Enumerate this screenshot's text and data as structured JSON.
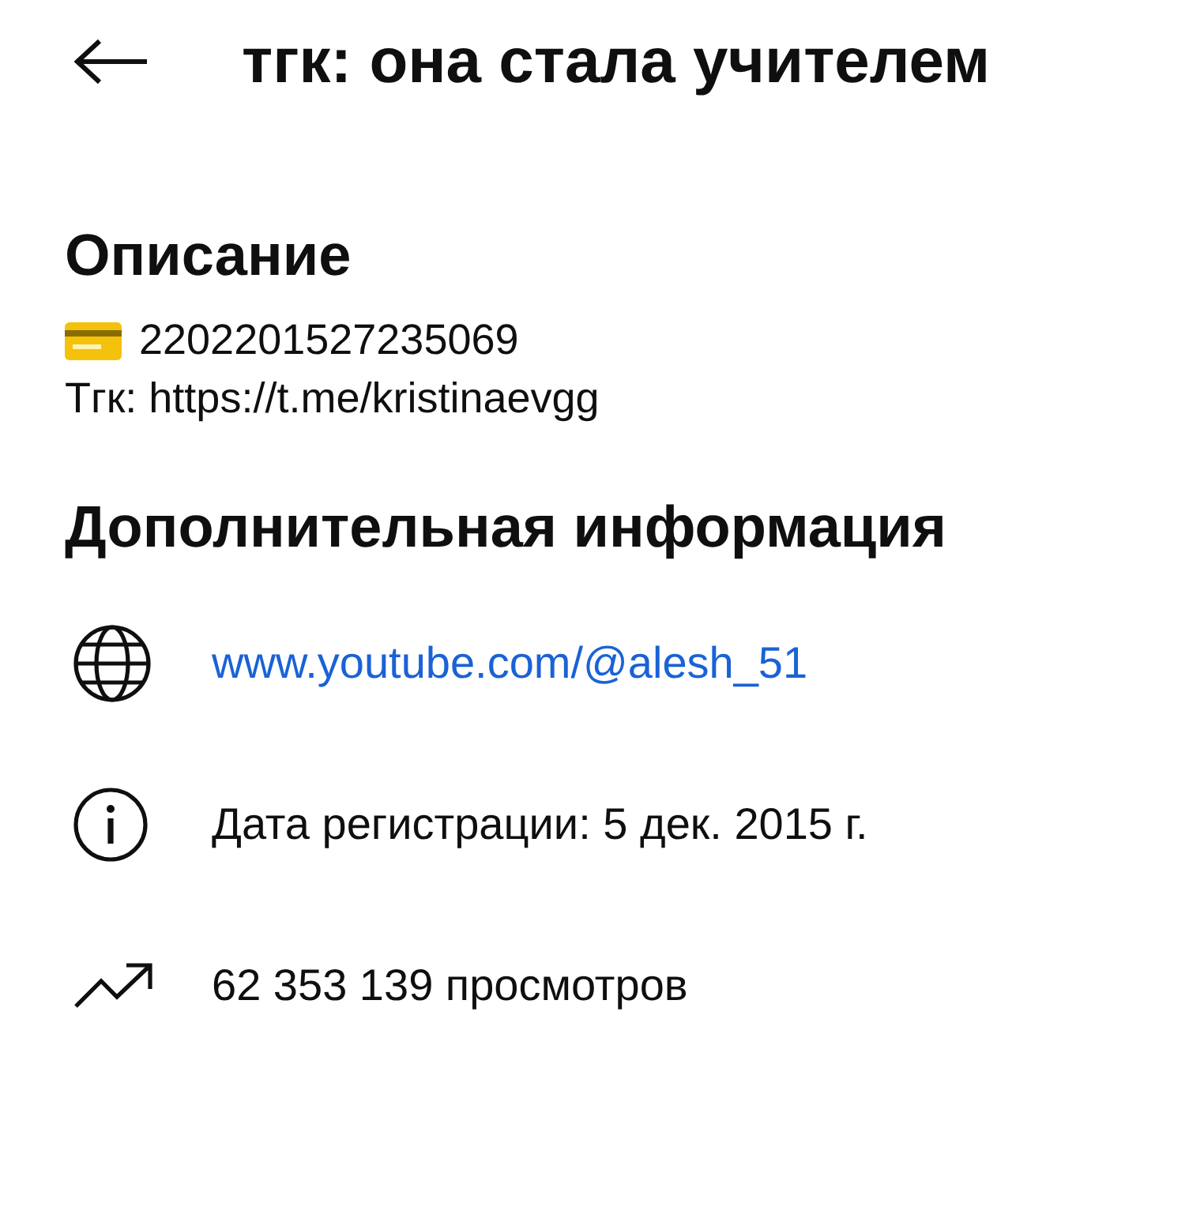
{
  "header": {
    "title": "тгк: она стала учителем"
  },
  "description": {
    "heading": "Описание",
    "lines": [
      {
        "kind": "card",
        "text": "2202201527235069"
      },
      {
        "kind": "plain",
        "text": "Тгк: https://t.me/kristinaevgg"
      }
    ]
  },
  "details": {
    "heading": "Дополнительная информация",
    "rows": [
      {
        "kind": "link",
        "text": "www.youtube.com/@alesh_51"
      },
      {
        "kind": "info",
        "text": "Дата регистрации: 5 дек. 2015 г."
      },
      {
        "kind": "views",
        "text": "62 353 139 просмотров"
      }
    ]
  }
}
